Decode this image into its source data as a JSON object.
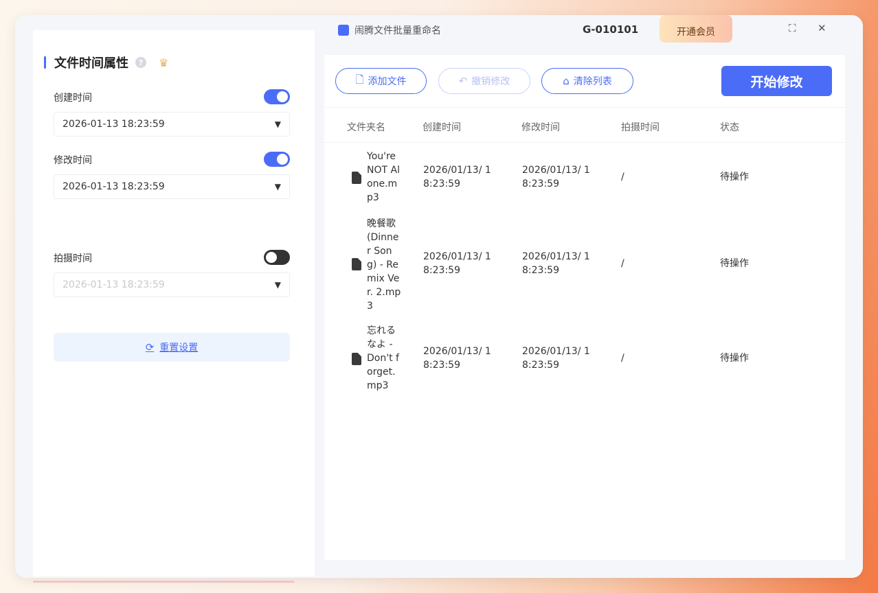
{
  "header": {
    "app_name": "闹腾文件批量重命名",
    "user_id": "G-010101",
    "vip_button": "开通会员",
    "fullscreen_icon": "⛶",
    "close_icon": "✕"
  },
  "left_panel": {
    "title": "文件时间属性",
    "created": {
      "label": "创建时间",
      "enabled": true,
      "value": "2026-01-13 18:23:59"
    },
    "modified": {
      "label": "修改时间",
      "enabled": true,
      "value": "2026-01-13 18:23:59"
    },
    "taken": {
      "label": "拍摄时间",
      "enabled": false,
      "value": "2026-01-13 18:23:59"
    },
    "reset_button": "重置设置"
  },
  "toolbar": {
    "add_files": "添加文件",
    "undo": "撤销修改",
    "clear": "清除列表",
    "start": "开始修改"
  },
  "table": {
    "columns": [
      "文件夹名",
      "创建时间",
      "修改时间",
      "拍摄时间",
      "状态"
    ],
    "rows": [
      {
        "name": "You're NOT Alone.mp3",
        "created": "2026/01/13/ 18:23:59",
        "modified": "2026/01/13/ 18:23:59",
        "taken": "/",
        "status": "待操作"
      },
      {
        "name": "晚餐歌 (Dinner Song) - Remix Ver. 2.mp3",
        "created": "2026/01/13/ 18:23:59",
        "modified": "2026/01/13/ 18:23:59",
        "taken": "/",
        "status": "待操作"
      },
      {
        "name": "忘れるなよ - Don't forget.mp3",
        "created": "2026/01/13/ 18:23:59",
        "modified": "2026/01/13/ 18:23:59",
        "taken": "/",
        "status": "待操作"
      }
    ]
  },
  "colors": {
    "accent": "#4a6cf7",
    "reset_bg": "#eef4fd"
  }
}
